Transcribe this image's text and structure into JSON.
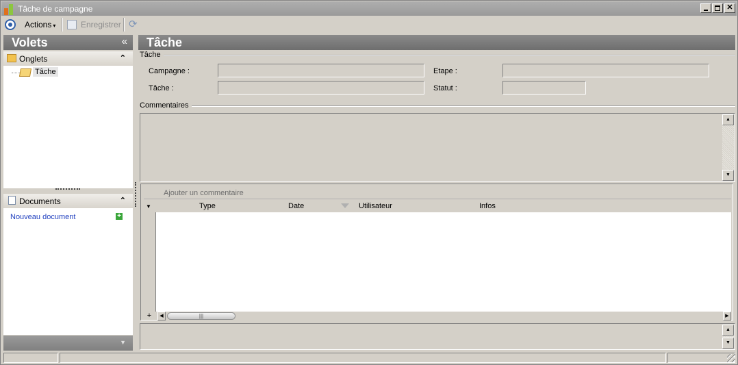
{
  "window": {
    "title": "Tâche de campagne"
  },
  "toolbar": {
    "actions_label": "Actions",
    "actions_caret": "▾",
    "save_label": "Enregistrer",
    "refresh_icon": "refresh-icon"
  },
  "left_pane": {
    "title": "Volets",
    "collapse_glyph": "«",
    "groups": [
      {
        "label": "Onglets",
        "icon": "folder-icon",
        "expanded_glyph": "⌃",
        "items": [
          {
            "label": "Tâche",
            "icon": "open-folder-icon",
            "selected": true
          }
        ]
      },
      {
        "label": "Documents",
        "icon": "document-icon",
        "expanded_glyph": "⌃",
        "items": [
          {
            "label": "Nouveau document",
            "icon": "add-icon"
          }
        ]
      }
    ],
    "footer_glyph": "▼"
  },
  "main": {
    "title": "Tâche",
    "task_section": {
      "label": "Tâche",
      "fields": {
        "campagne": {
          "label": "Campagne :",
          "value": ""
        },
        "etape": {
          "label": "Etape :",
          "value": ""
        },
        "tache": {
          "label": "Tâche :",
          "value": ""
        },
        "statut": {
          "label": "Statut :",
          "value": ""
        }
      }
    },
    "comments_section": {
      "label": "Commentaires",
      "value": ""
    },
    "grid": {
      "add_label": "Ajouter un commentaire",
      "columns": [
        "Type",
        "Date",
        "Utilisateur",
        "Infos"
      ],
      "sorted_column": "Date",
      "rows": [],
      "expand_all_glyph": "+",
      "scroll_thumb_glyph": "|||"
    }
  },
  "statusbar": {
    "cells": [
      "",
      "",
      ""
    ]
  }
}
